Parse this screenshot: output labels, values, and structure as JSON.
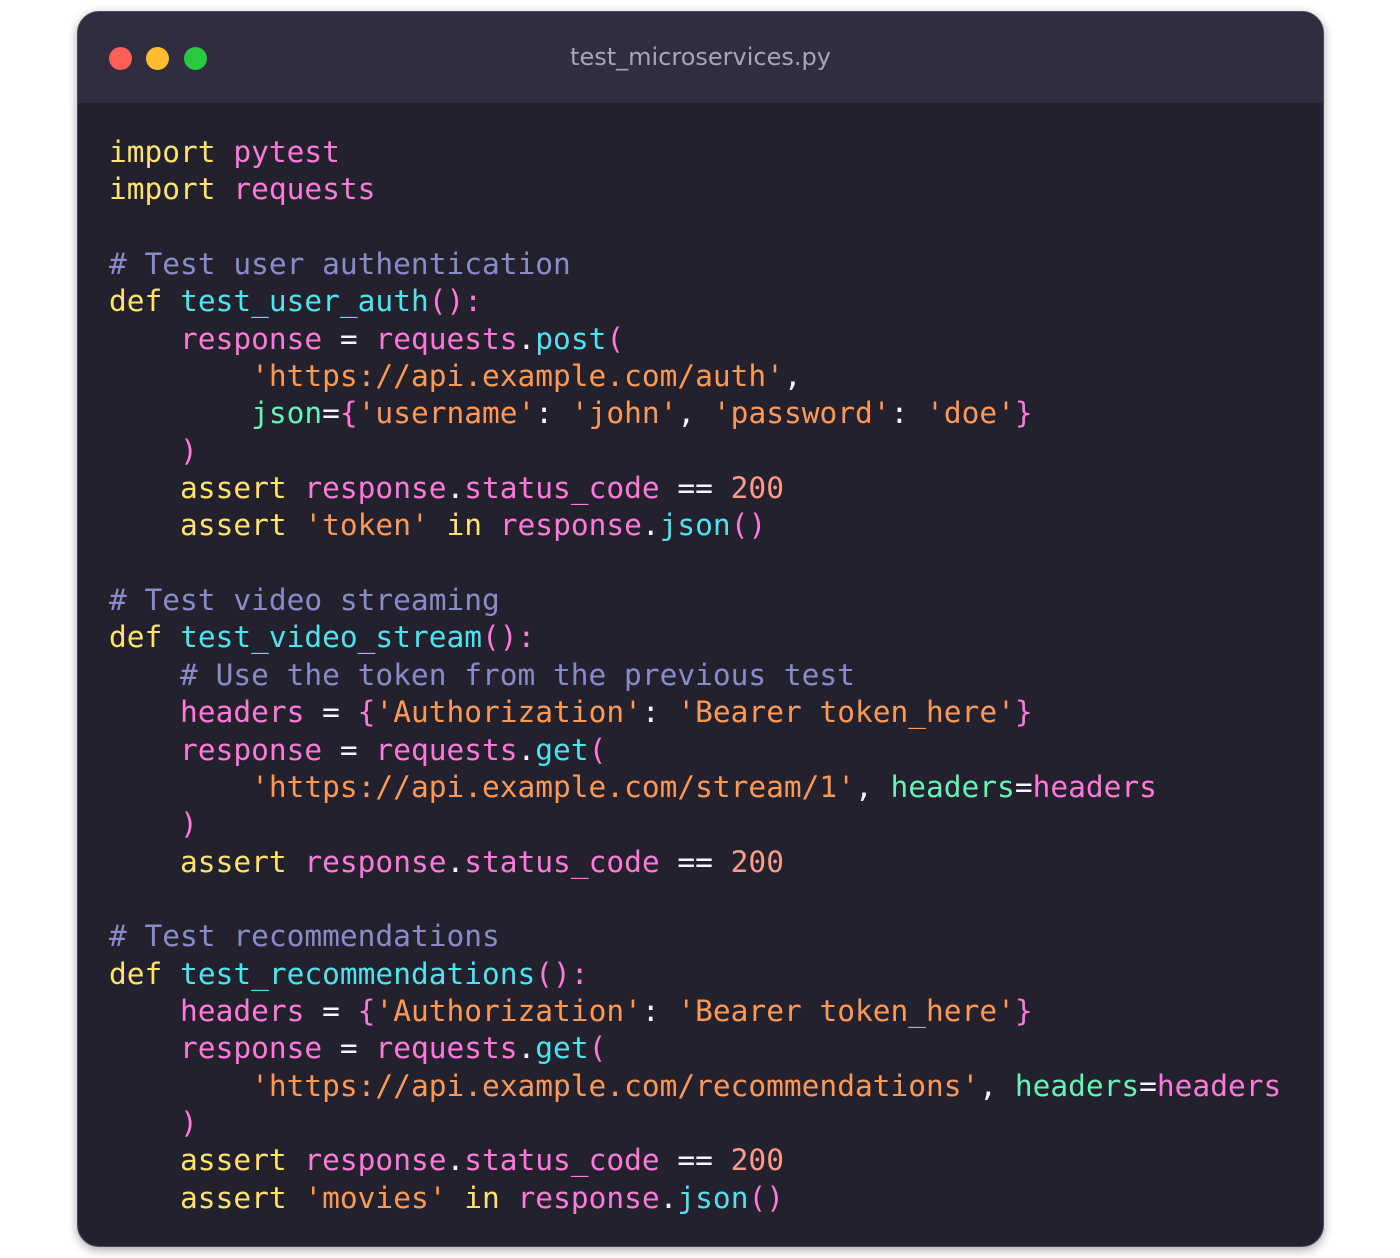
{
  "window": {
    "title": "test_microservices.py"
  },
  "colors": {
    "background": "#24212f",
    "titlebar": "#2f2d3e",
    "keyword": "#ffe36e",
    "function": "#4fe3ef",
    "string": "#ff9955",
    "comment": "#8a8cc9",
    "variable": "#ff7ad9",
    "parameter": "#65f5b5",
    "number": "#ff9b8a"
  },
  "code_lines": [
    [
      [
        "keyword",
        "import"
      ],
      [
        "plain",
        " "
      ],
      [
        "module",
        "pytest"
      ]
    ],
    [
      [
        "keyword",
        "import"
      ],
      [
        "plain",
        " "
      ],
      [
        "module",
        "requests"
      ]
    ],
    [],
    [
      [
        "comment",
        "# Test user authentication"
      ]
    ],
    [
      [
        "keyword",
        "def"
      ],
      [
        "plain",
        " "
      ],
      [
        "func",
        "test_user_auth"
      ],
      [
        "punct",
        "():"
      ]
    ],
    [
      [
        "plain",
        "    "
      ],
      [
        "var",
        "response"
      ],
      [
        "op",
        " = "
      ],
      [
        "var",
        "requests"
      ],
      [
        "op",
        "."
      ],
      [
        "method",
        "post"
      ],
      [
        "punct",
        "("
      ]
    ],
    [
      [
        "plain",
        "        "
      ],
      [
        "string",
        "'https://api.example.com/auth'"
      ],
      [
        "op",
        ","
      ]
    ],
    [
      [
        "plain",
        "        "
      ],
      [
        "param",
        "json"
      ],
      [
        "op",
        "="
      ],
      [
        "punct",
        "{"
      ],
      [
        "string",
        "'username'"
      ],
      [
        "op",
        ": "
      ],
      [
        "string",
        "'john'"
      ],
      [
        "op",
        ", "
      ],
      [
        "string",
        "'password'"
      ],
      [
        "op",
        ": "
      ],
      [
        "string",
        "'doe'"
      ],
      [
        "punct",
        "}"
      ]
    ],
    [
      [
        "plain",
        "    "
      ],
      [
        "punct",
        ")"
      ]
    ],
    [
      [
        "plain",
        "    "
      ],
      [
        "keyword",
        "assert"
      ],
      [
        "plain",
        " "
      ],
      [
        "var",
        "response"
      ],
      [
        "op",
        "."
      ],
      [
        "var",
        "status_code"
      ],
      [
        "op",
        " == "
      ],
      [
        "number",
        "200"
      ]
    ],
    [
      [
        "plain",
        "    "
      ],
      [
        "keyword",
        "assert"
      ],
      [
        "plain",
        " "
      ],
      [
        "string",
        "'token'"
      ],
      [
        "plain",
        " "
      ],
      [
        "keyword",
        "in"
      ],
      [
        "plain",
        " "
      ],
      [
        "var",
        "response"
      ],
      [
        "op",
        "."
      ],
      [
        "method",
        "json"
      ],
      [
        "punct",
        "()"
      ]
    ],
    [],
    [
      [
        "comment",
        "# Test video streaming"
      ]
    ],
    [
      [
        "keyword",
        "def"
      ],
      [
        "plain",
        " "
      ],
      [
        "func",
        "test_video_stream"
      ],
      [
        "punct",
        "():"
      ]
    ],
    [
      [
        "plain",
        "    "
      ],
      [
        "comment",
        "# Use the token from the previous test"
      ]
    ],
    [
      [
        "plain",
        "    "
      ],
      [
        "var",
        "headers"
      ],
      [
        "op",
        " = "
      ],
      [
        "punct",
        "{"
      ],
      [
        "string",
        "'Authorization'"
      ],
      [
        "op",
        ": "
      ],
      [
        "string",
        "'Bearer token_here'"
      ],
      [
        "punct",
        "}"
      ]
    ],
    [
      [
        "plain",
        "    "
      ],
      [
        "var",
        "response"
      ],
      [
        "op",
        " = "
      ],
      [
        "var",
        "requests"
      ],
      [
        "op",
        "."
      ],
      [
        "method",
        "get"
      ],
      [
        "punct",
        "("
      ]
    ],
    [
      [
        "plain",
        "        "
      ],
      [
        "string",
        "'https://api.example.com/stream/1'"
      ],
      [
        "op",
        ", "
      ],
      [
        "param",
        "headers"
      ],
      [
        "op",
        "="
      ],
      [
        "var",
        "headers"
      ]
    ],
    [
      [
        "plain",
        "    "
      ],
      [
        "punct",
        ")"
      ]
    ],
    [
      [
        "plain",
        "    "
      ],
      [
        "keyword",
        "assert"
      ],
      [
        "plain",
        " "
      ],
      [
        "var",
        "response"
      ],
      [
        "op",
        "."
      ],
      [
        "var",
        "status_code"
      ],
      [
        "op",
        " == "
      ],
      [
        "number",
        "200"
      ]
    ],
    [],
    [
      [
        "comment",
        "# Test recommendations"
      ]
    ],
    [
      [
        "keyword",
        "def"
      ],
      [
        "plain",
        " "
      ],
      [
        "func",
        "test_recommendations"
      ],
      [
        "punct",
        "():"
      ]
    ],
    [
      [
        "plain",
        "    "
      ],
      [
        "var",
        "headers"
      ],
      [
        "op",
        " = "
      ],
      [
        "punct",
        "{"
      ],
      [
        "string",
        "'Authorization'"
      ],
      [
        "op",
        ": "
      ],
      [
        "string",
        "'Bearer token_here'"
      ],
      [
        "punct",
        "}"
      ]
    ],
    [
      [
        "plain",
        "    "
      ],
      [
        "var",
        "response"
      ],
      [
        "op",
        " = "
      ],
      [
        "var",
        "requests"
      ],
      [
        "op",
        "."
      ],
      [
        "method",
        "get"
      ],
      [
        "punct",
        "("
      ]
    ],
    [
      [
        "plain",
        "        "
      ],
      [
        "string",
        "'https://api.example.com/recommendations'"
      ],
      [
        "op",
        ", "
      ],
      [
        "param",
        "headers"
      ],
      [
        "op",
        "="
      ],
      [
        "var",
        "headers"
      ]
    ],
    [
      [
        "plain",
        "    "
      ],
      [
        "punct",
        ")"
      ]
    ],
    [
      [
        "plain",
        "    "
      ],
      [
        "keyword",
        "assert"
      ],
      [
        "plain",
        " "
      ],
      [
        "var",
        "response"
      ],
      [
        "op",
        "."
      ],
      [
        "var",
        "status_code"
      ],
      [
        "op",
        " == "
      ],
      [
        "number",
        "200"
      ]
    ],
    [
      [
        "plain",
        "    "
      ],
      [
        "keyword",
        "assert"
      ],
      [
        "plain",
        " "
      ],
      [
        "string",
        "'movies'"
      ],
      [
        "plain",
        " "
      ],
      [
        "keyword",
        "in"
      ],
      [
        "plain",
        " "
      ],
      [
        "var",
        "response"
      ],
      [
        "op",
        "."
      ],
      [
        "method",
        "json"
      ],
      [
        "punct",
        "()"
      ]
    ]
  ]
}
